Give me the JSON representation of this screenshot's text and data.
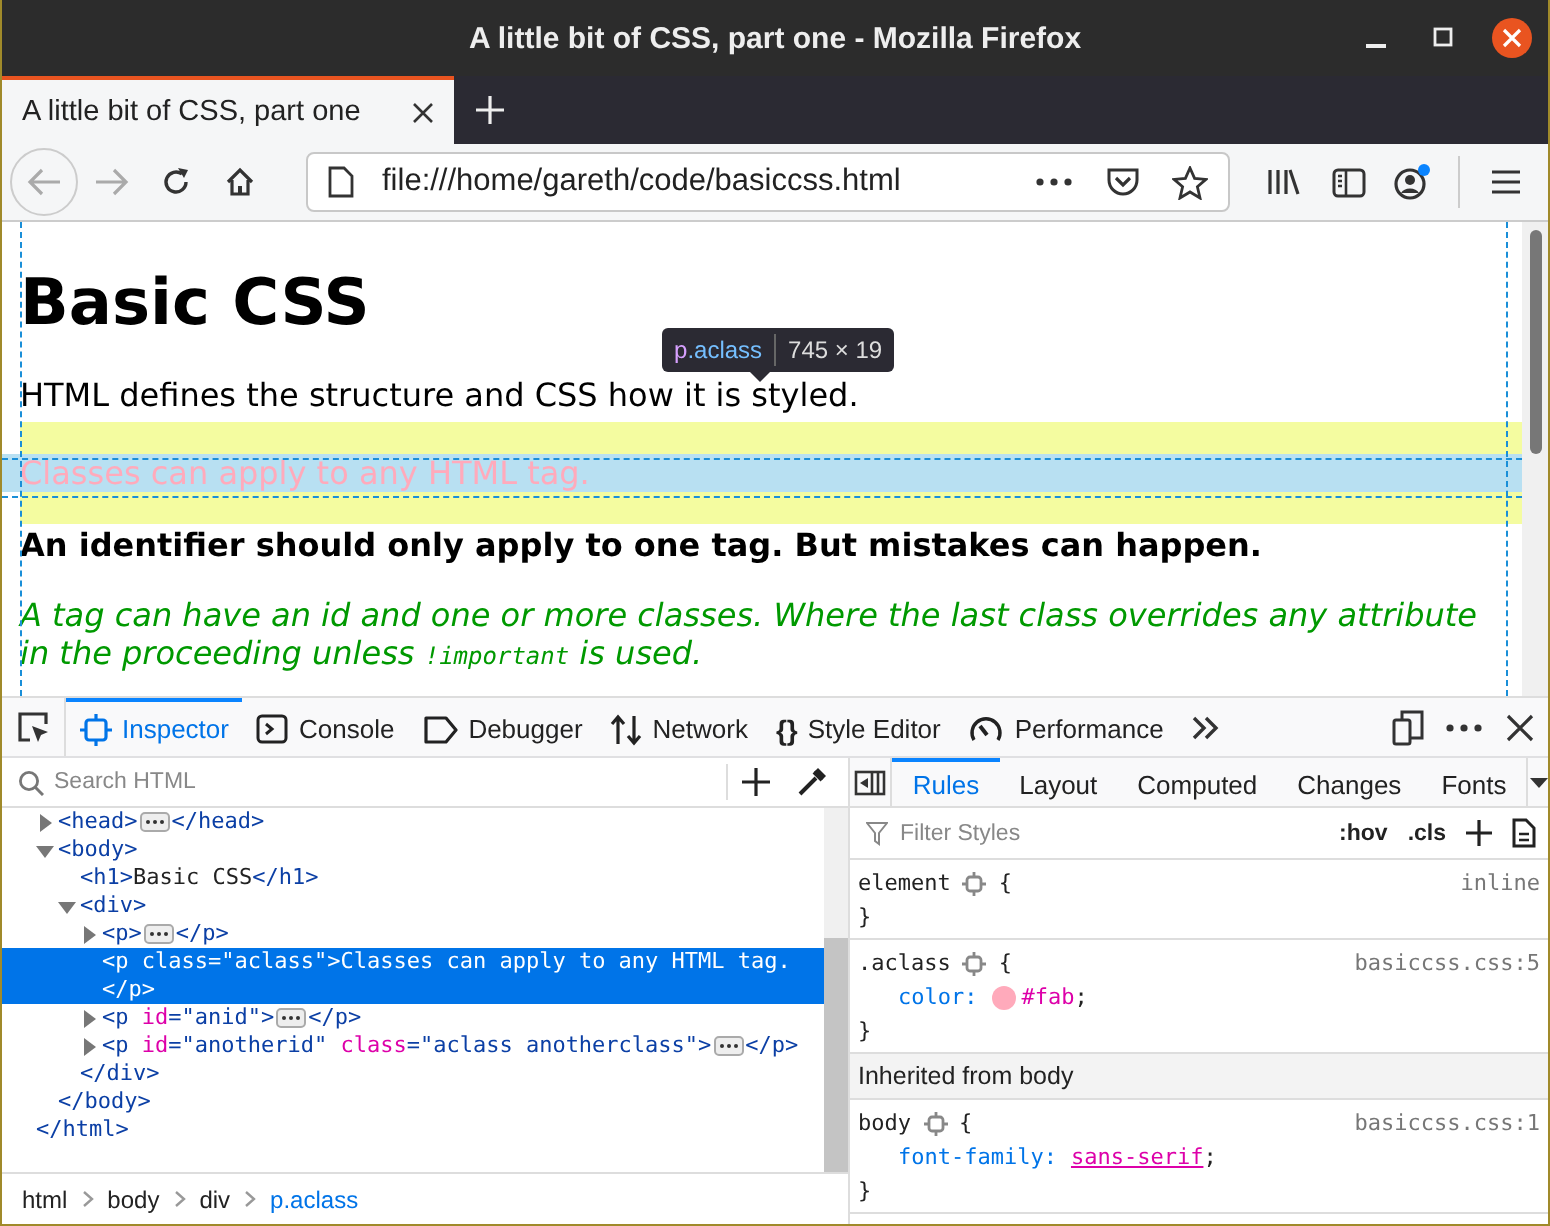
{
  "window": {
    "title": "A little bit of CSS, part one - Mozilla Firefox"
  },
  "browser_tabs": [
    {
      "label": "A little bit of CSS, part one",
      "selected": true
    }
  ],
  "toolbar": {
    "url": "file:///home/gareth/code/basiccss.html"
  },
  "page": {
    "heading": "Basic CSS",
    "paragraphs": [
      {
        "kind": "plain",
        "parts": [
          {
            "text": "HTML defines the structure and CSS how it is styled."
          }
        ]
      },
      {
        "kind": "highlighted",
        "parts": [
          {
            "text": "Classes can apply to any HTML tag."
          }
        ]
      },
      {
        "kind": "bold",
        "parts": [
          {
            "text": "An identifier should only apply to one tag. But mistakes can happen."
          }
        ]
      },
      {
        "kind": "italic",
        "parts": [
          {
            "text": "A tag can have an id and one or more classes. Where the last class overrides any attribute in the proceeding unless "
          },
          {
            "text": "!important",
            "kind": "code"
          },
          {
            "text": " is used."
          }
        ]
      }
    ],
    "tooltip": {
      "tag": "p",
      "class": ".aclass",
      "size": "745 × 19"
    }
  },
  "devtools": {
    "tabs": [
      {
        "label": "Inspector",
        "selected": true
      },
      {
        "label": "Console",
        "selected": false
      },
      {
        "label": "Debugger",
        "selected": false
      },
      {
        "label": "Network",
        "selected": false
      },
      {
        "label": "Style Editor",
        "selected": false,
        "glyph": "{}"
      },
      {
        "label": "Performance",
        "selected": false
      }
    ],
    "search": {
      "placeholder": "Search HTML"
    },
    "markup": {
      "nodes": [
        {
          "kind": "collapsed",
          "selected": false,
          "tokens": [
            {
              "t": "<head>",
              "kind": "tag"
            }
          ],
          "close": [
            {
              "t": "</head>",
              "kind": "tag"
            }
          ]
        },
        {
          "kind": "expanded",
          "selected": false,
          "tokens": [
            {
              "t": "<body>",
              "kind": "tag"
            }
          ],
          "close": [
            {
              "t": "</body>",
              "kind": "tag"
            }
          ],
          "children": [
            {
              "kind": "leaf",
              "selected": false,
              "tokens": [
                {
                  "t": "<h1>",
                  "kind": "tag"
                },
                {
                  "t": "Basic CSS",
                  "kind": "text"
                }
              ],
              "close": [
                {
                  "t": "</h1>",
                  "kind": "tag"
                }
              ]
            },
            {
              "kind": "expanded",
              "selected": false,
              "tokens": [
                {
                  "t": "<div>",
                  "kind": "tag"
                }
              ],
              "close": [
                {
                  "t": "</div>",
                  "kind": "tag"
                }
              ],
              "children": [
                {
                  "kind": "collapsed",
                  "selected": false,
                  "tokens": [
                    {
                      "t": "<p>",
                      "kind": "tag"
                    }
                  ],
                  "close": [
                    {
                      "t": "</p>",
                      "kind": "tag"
                    }
                  ]
                },
                {
                  "kind": "wrapped",
                  "selected": true,
                  "tokens": [
                    {
                      "t": "<p ",
                      "kind": "tag"
                    },
                    {
                      "t": "class",
                      "kind": "attr"
                    },
                    {
                      "t": "=\"aclass\"",
                      "kind": "val"
                    },
                    {
                      "t": ">",
                      "kind": "tag"
                    },
                    {
                      "t": "Classes can apply to any HTML tag.",
                      "kind": "text"
                    }
                  ],
                  "close": [
                    {
                      "t": "</p>",
                      "kind": "tag"
                    }
                  ]
                },
                {
                  "kind": "collapsed",
                  "selected": false,
                  "tokens": [
                    {
                      "t": "<p ",
                      "kind": "tag"
                    },
                    {
                      "t": "id",
                      "kind": "attr"
                    },
                    {
                      "t": "=\"anid\"",
                      "kind": "val"
                    },
                    {
                      "t": ">",
                      "kind": "tag"
                    }
                  ],
                  "close": [
                    {
                      "t": "</p>",
                      "kind": "tag"
                    }
                  ]
                },
                {
                  "kind": "collapsed",
                  "selected": false,
                  "tokens": [
                    {
                      "t": "<p ",
                      "kind": "tag"
                    },
                    {
                      "t": "id",
                      "kind": "attr"
                    },
                    {
                      "t": "=\"anotherid\" ",
                      "kind": "val"
                    },
                    {
                      "t": "class",
                      "kind": "attr"
                    },
                    {
                      "t": "=\"aclass anotherclass\"",
                      "kind": "val"
                    },
                    {
                      "t": ">",
                      "kind": "tag"
                    }
                  ],
                  "close": [
                    {
                      "t": "</p>",
                      "kind": "tag"
                    }
                  ]
                }
              ]
            }
          ]
        }
      ],
      "closing": [
        {
          "t": "</html>",
          "kind": "tag"
        }
      ]
    },
    "breadcrumbs": [
      {
        "label": "html",
        "selected": false
      },
      {
        "label": "body",
        "selected": false
      },
      {
        "label": "div",
        "selected": false
      },
      {
        "label": "p.aclass",
        "selected": true
      }
    ],
    "sidebar_tabs": [
      {
        "label": "Rules",
        "selected": true
      },
      {
        "label": "Layout",
        "selected": false
      },
      {
        "label": "Computed",
        "selected": false
      },
      {
        "label": "Changes",
        "selected": false
      },
      {
        "label": "Fonts",
        "selected": false
      }
    ],
    "filter": {
      "placeholder": "Filter Styles",
      "hov": ":hov",
      "cls": ".cls"
    },
    "rules": [
      {
        "kind": "rule",
        "selector": "element",
        "open": "{",
        "close": "}",
        "source": "inline"
      },
      {
        "kind": "rule",
        "selector": ".aclass",
        "open": "{",
        "close": "}",
        "source": "basiccss.css:5",
        "declarations": [
          {
            "property": "color:",
            "value": "#fab",
            "end": ";",
            "color": "#ffaabb",
            "link": false
          }
        ]
      },
      {
        "kind": "header",
        "text": "Inherited from body"
      },
      {
        "kind": "rule",
        "selector": "body",
        "open": "{",
        "close": "}",
        "source": "basiccss.css:1",
        "declarations": [
          {
            "property": "font-family:",
            "value": "sans-serif",
            "end": ";",
            "link": true
          }
        ]
      }
    ]
  }
}
